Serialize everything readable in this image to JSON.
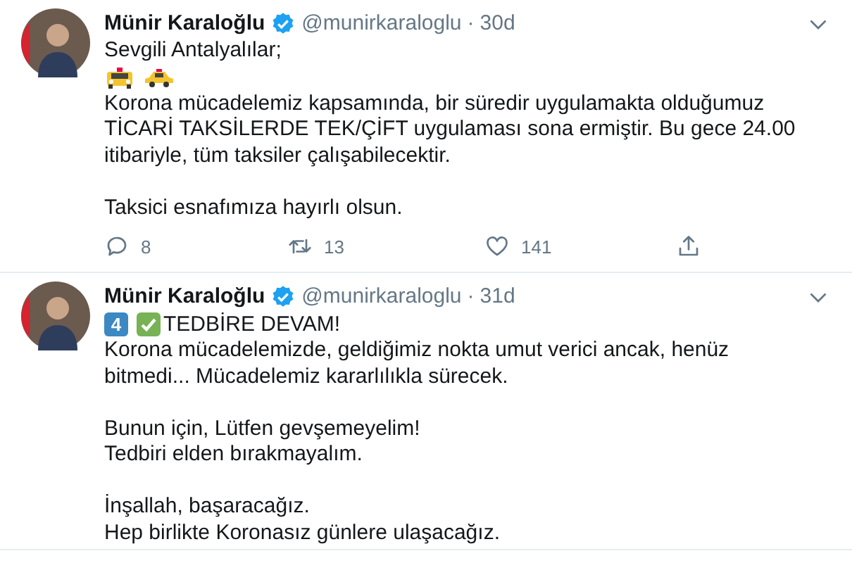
{
  "tweets": [
    {
      "name": "Münir Karaloğlu",
      "handle": "@munirkaraloglu",
      "separator": "·",
      "time": "30d",
      "verified": true,
      "body": [
        {
          "kind": "text",
          "text": "Sevgili Antalyalılar;"
        },
        {
          "kind": "taxis"
        },
        {
          "kind": "text",
          "text": "Korona mücadelemiz kapsamında, bir süredir uygulamakta olduğumuz TİCARİ TAKSİLERDE TEK/ÇİFT uygulaması sona ermiştir. Bu gece 24.00 itibariyle, tüm taksiler çalışabilecektir.\n\nTaksici esnafımıza hayırlı olsun."
        }
      ],
      "actions": [
        {
          "kind": "reply",
          "count": "8"
        },
        {
          "kind": "retweet",
          "count": "13"
        },
        {
          "kind": "like",
          "count": "141"
        },
        {
          "kind": "share"
        }
      ]
    },
    {
      "name": "Münir Karaloğlu",
      "handle": "@munirkaraloglu",
      "separator": "·",
      "time": "31d",
      "verified": true,
      "body": [
        {
          "kind": "headline",
          "keycap": "4",
          "text": "TEDBİRE DEVAM!"
        },
        {
          "kind": "text",
          "text": "Korona mücadelemizde, geldiğimiz nokta umut verici ancak, henüz bitmedi... Mücadelemiz kararlılıkla sürecek.\n\nBunun için, Lütfen gevşemeyelim!\nTedbiri elden bırakmayalım.\n\nİnşallah, başaracağız.\nHep birlikte Koronasız günlere ulaşacağız."
        }
      ]
    }
  ]
}
